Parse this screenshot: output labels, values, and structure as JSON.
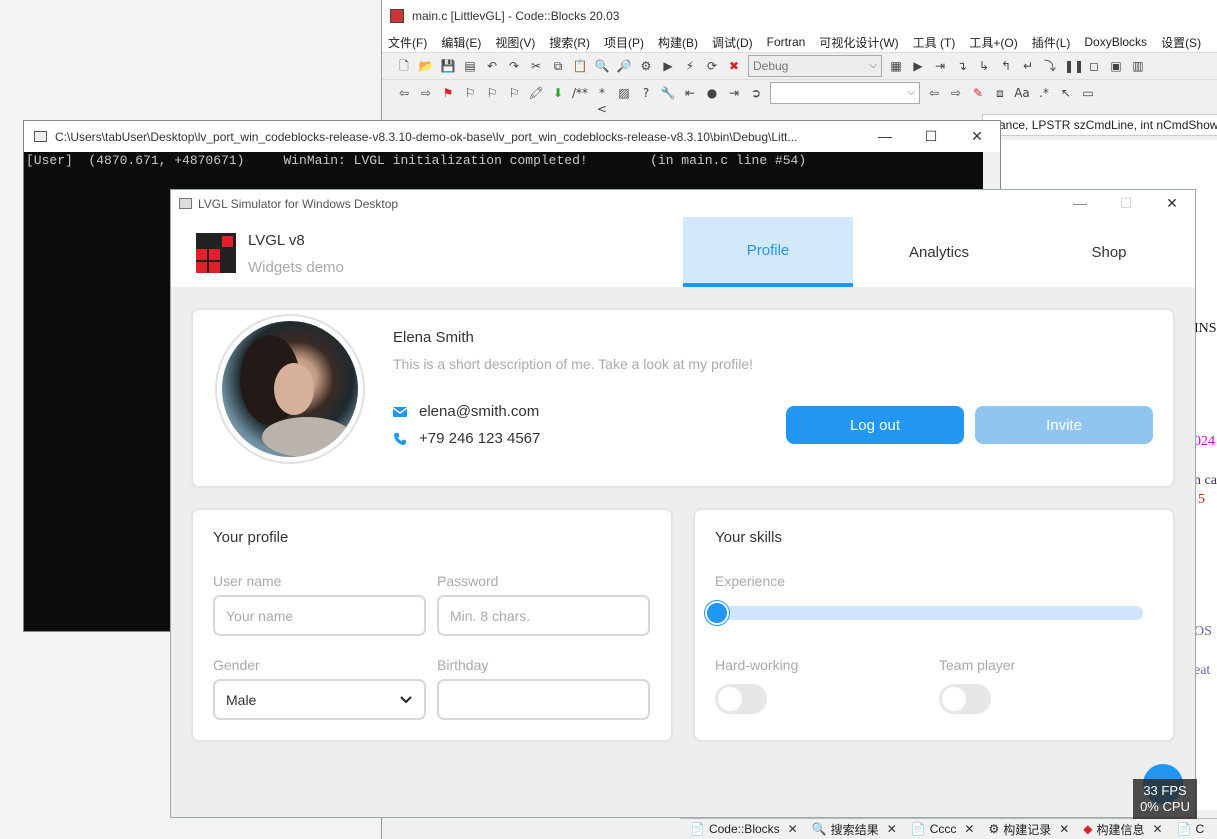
{
  "codeblocks": {
    "title": "main.c [LittlevGL] - Code::Blocks 20.03",
    "menu": [
      "文件(F)",
      "编辑(E)",
      "视图(V)",
      "搜索(R)",
      "项目(P)",
      "构建(B)",
      "调试(D)",
      "Fortran",
      "可视化设计(W)",
      "工具 (T)",
      "工具+(O)",
      "插件(L)",
      "DoxyBlocks",
      "设置(S)"
    ],
    "build_target": "Debug",
    "function_signature": "ance, LPSTR szCmdLine, int nCmdShow",
    "code_fragments": [
      "INS",
      "024",
      "n ca",
      "5",
      "OS",
      "eat"
    ],
    "bottom_tabs": [
      "Code::Blocks",
      "搜索结果",
      "Cccc",
      "构建记录",
      "构建信息",
      "C"
    ]
  },
  "console": {
    "title": "C:\\Users\\tabUser\\Desktop\\lv_port_win_codeblocks-release-v8.3.10-demo-ok-base\\lv_port_win_codeblocks-release-v8.3.10\\bin\\Debug\\Litt...",
    "line": "[User]  (4870.671, +4870671)     WinMain: LVGL initialization completed!        (in main.c line #54)"
  },
  "lvgl": {
    "window_title": "LVGL Simulator for Windows Desktop",
    "app_title": "LVGL v8",
    "app_subtitle": "Widgets demo",
    "tabs": [
      "Profile",
      "Analytics",
      "Shop"
    ],
    "active_tab": "Profile",
    "profile": {
      "name": "Elena Smith",
      "description": "This is a short description of me. Take a look at my profile!",
      "email": "elena@smith.com",
      "phone": "+79 246 123 4567",
      "logout_label": "Log out",
      "invite_label": "Invite"
    },
    "your_profile": {
      "title": "Your profile",
      "username_label": "User name",
      "username_placeholder": "Your name",
      "password_label": "Password",
      "password_placeholder": "Min. 8 chars.",
      "gender_label": "Gender",
      "gender_value": "Male",
      "birthday_label": "Birthday",
      "birthday_value": ""
    },
    "your_skills": {
      "title": "Your skills",
      "experience_label": "Experience",
      "experience_value": 0,
      "hardworking_label": "Hard-working",
      "hardworking_on": false,
      "teamplayer_label": "Team player",
      "teamplayer_on": false
    },
    "accent_color": "#2196f3",
    "fps": "33 FPS",
    "cpu": "0% CPU"
  }
}
